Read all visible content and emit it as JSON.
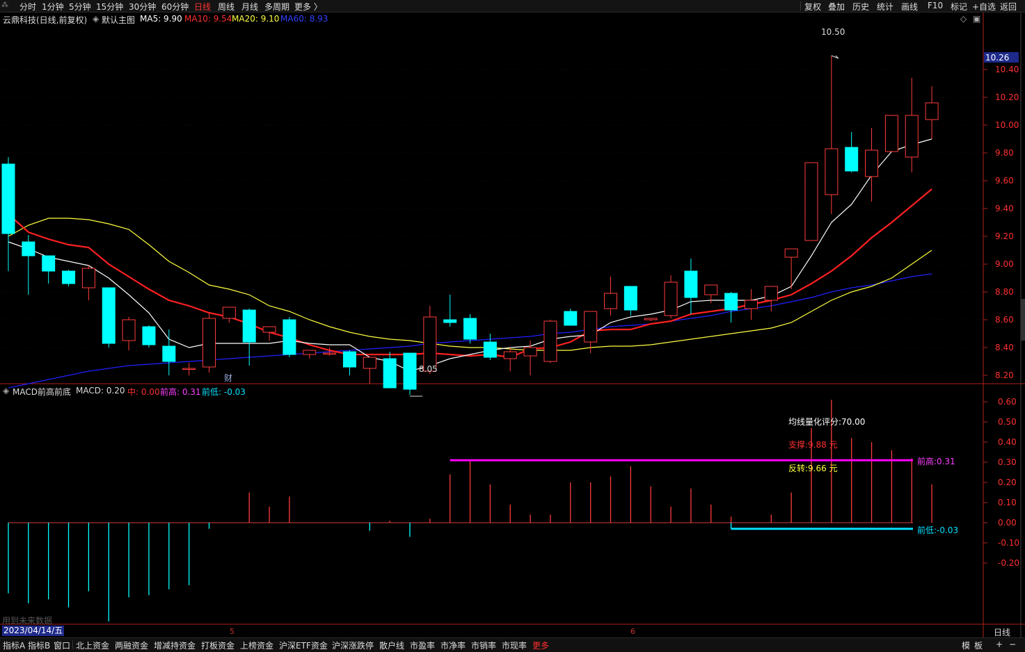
{
  "toolbar": {
    "periods": [
      "分时",
      "1分钟",
      "5分钟",
      "15分钟",
      "30分钟",
      "60分钟",
      "日线",
      "周线",
      "月线",
      "多周期",
      "更多 〉"
    ],
    "active_period": "日线",
    "right_buttons": [
      "复权",
      "叠加",
      "历史",
      "统计",
      "画线",
      "F10",
      "标记",
      "+自选",
      "返回"
    ]
  },
  "main_info": {
    "title": "云鼎科技(日线,前复权)",
    "template": "默认主图",
    "ma5": "MA5: 9.90",
    "ma10": "MA10: 9.54",
    "ma20": "MA20: 9.10",
    "ma60": "MA60: 8.93"
  },
  "macd_info": {
    "title": "MACD前高前底",
    "macd": "MACD: 0.20",
    "zhong": "中: 0.00",
    "qiangao": "前高: 0.31",
    "qiandi": "前低: -0.03"
  },
  "annotations": {
    "high_label": "10.50",
    "low_label": "8.05",
    "cai": "财",
    "score": "均线量化评分:70.00",
    "support": "支撑:9.88 元",
    "reversal": "反转:9.66 元",
    "prev_high": "前高:0.31",
    "prev_low": "前低:-0.03",
    "future_hint": "用到未来数据",
    "current_price": "10.26"
  },
  "bottom": {
    "date": "2023/04/14/五",
    "month_marks": [
      "5",
      "6"
    ],
    "day_label": "日线",
    "tabs": [
      "指标A",
      "指标B",
      "窗口",
      "北上资金",
      "两融资金",
      "增减持资金",
      "打板资金",
      "上榜资金",
      "沪深ETF资金",
      "沪深涨跌停",
      "散户线",
      "市盈率",
      "市净率",
      "市销率",
      "市现率",
      "更多"
    ],
    "right_tabs": [
      "模",
      "板",
      "+",
      "−"
    ]
  },
  "colors": {
    "up": "#ff3b3b",
    "down": "#00ffff",
    "ma5": "#ffffff",
    "ma10": "#ff2020",
    "ma20": "#ffff40",
    "ma60": "#2020ff",
    "prev_high_line": "#ff00ff",
    "prev_low_line": "#00e0ff"
  },
  "chart_data": [
    {
      "type": "candlestick",
      "title": "云鼎科技(日线,前复权)",
      "yticks": [
        "8.20",
        "8.40",
        "8.60",
        "8.80",
        "9.00",
        "9.20",
        "9.40",
        "9.60",
        "9.80",
        "10.00",
        "10.20",
        "10.40"
      ],
      "ylim": [
        8.0,
        10.5
      ],
      "ohlc": [
        [
          9.72,
          9.77,
          8.95,
          9.22
        ],
        [
          9.16,
          9.21,
          8.78,
          9.06
        ],
        [
          9.06,
          9.06,
          8.86,
          8.95
        ],
        [
          8.95,
          8.96,
          8.84,
          8.86
        ],
        [
          8.83,
          8.99,
          8.74,
          8.97
        ],
        [
          8.83,
          8.83,
          8.4,
          8.43
        ],
        [
          8.45,
          8.62,
          8.38,
          8.6
        ],
        [
          8.55,
          8.56,
          8.4,
          8.42
        ],
        [
          8.41,
          8.53,
          8.2,
          8.3
        ],
        [
          8.25,
          8.29,
          8.2,
          8.25
        ],
        [
          8.26,
          8.65,
          8.22,
          8.61
        ],
        [
          8.61,
          8.69,
          8.58,
          8.69
        ],
        [
          8.67,
          8.68,
          8.27,
          8.44
        ],
        [
          8.51,
          8.55,
          8.45,
          8.55
        ],
        [
          8.6,
          8.62,
          8.33,
          8.35
        ],
        [
          8.35,
          8.38,
          8.32,
          8.38
        ],
        [
          8.36,
          8.4,
          8.34,
          8.36
        ],
        [
          8.37,
          8.38,
          8.2,
          8.26
        ],
        [
          8.25,
          8.32,
          8.14,
          8.33
        ],
        [
          8.32,
          8.37,
          8.11,
          8.11
        ],
        [
          8.36,
          8.32,
          8.06,
          8.1
        ],
        [
          8.23,
          8.7,
          8.21,
          8.62
        ],
        [
          8.6,
          8.78,
          8.55,
          8.58
        ],
        [
          8.61,
          8.64,
          8.43,
          8.46
        ],
        [
          8.44,
          8.5,
          8.31,
          8.33
        ],
        [
          8.32,
          8.4,
          8.23,
          8.37
        ],
        [
          8.34,
          8.45,
          8.2,
          8.4
        ],
        [
          8.3,
          8.6,
          8.29,
          8.59
        ],
        [
          8.66,
          8.68,
          8.56,
          8.56
        ],
        [
          8.44,
          8.66,
          8.36,
          8.66
        ],
        [
          8.68,
          8.91,
          8.63,
          8.79
        ],
        [
          8.84,
          8.84,
          8.63,
          8.67
        ],
        [
          8.6,
          8.61,
          8.59,
          8.61
        ],
        [
          8.63,
          8.92,
          8.61,
          8.87
        ],
        [
          8.95,
          9.04,
          8.64,
          8.76
        ],
        [
          8.78,
          8.84,
          8.72,
          8.85
        ],
        [
          8.79,
          8.8,
          8.58,
          8.67
        ],
        [
          8.68,
          8.82,
          8.6,
          8.74
        ],
        [
          8.74,
          8.8,
          8.66,
          8.84
        ],
        [
          9.05,
          9.1,
          8.82,
          9.11
        ],
        [
          9.17,
          9.35,
          9.21,
          9.73
        ],
        [
          9.5,
          10.5,
          9.36,
          9.83
        ],
        [
          9.84,
          9.95,
          9.66,
          9.67
        ],
        [
          9.63,
          9.98,
          9.45,
          9.82
        ],
        [
          9.81,
          10.06,
          9.82,
          10.07
        ],
        [
          9.77,
          10.34,
          9.66,
          10.07
        ],
        [
          10.04,
          10.28,
          9.9,
          10.16
        ]
      ],
      "ma5": [
        9.16,
        9.11,
        9.05,
        9.02,
        8.99,
        8.9,
        8.78,
        8.65,
        8.46,
        8.4,
        8.43,
        8.43,
        8.43,
        8.43,
        8.45,
        8.43,
        8.42,
        8.42,
        8.33,
        8.3,
        8.23,
        8.27,
        8.32,
        8.35,
        8.38,
        8.4,
        8.41,
        8.46,
        8.48,
        8.49,
        8.58,
        8.62,
        8.64,
        8.67,
        8.73,
        8.74,
        8.74,
        8.74,
        8.77,
        8.84,
        9.06,
        9.3,
        9.43,
        9.64,
        9.81,
        9.86,
        9.9
      ],
      "ma10": [
        9.36,
        9.23,
        9.18,
        9.14,
        9.12,
        9.0,
        8.91,
        8.82,
        8.74,
        8.7,
        8.65,
        8.62,
        8.57,
        8.51,
        8.47,
        8.42,
        8.38,
        8.35,
        8.35,
        8.35,
        8.35,
        8.36,
        8.35,
        8.34,
        8.35,
        8.33,
        8.39,
        8.4,
        8.44,
        8.52,
        8.53,
        8.53,
        8.57,
        8.59,
        8.64,
        8.66,
        8.68,
        8.71,
        8.74,
        8.78,
        8.86,
        8.95,
        9.06,
        9.19,
        9.3,
        9.42,
        9.54
      ],
      "ma20": [
        9.2,
        9.28,
        9.33,
        9.33,
        9.32,
        9.29,
        9.25,
        9.14,
        9.02,
        8.94,
        8.85,
        8.82,
        8.78,
        8.7,
        8.66,
        8.6,
        8.55,
        8.51,
        8.48,
        8.46,
        8.45,
        8.43,
        8.41,
        8.4,
        8.4,
        8.39,
        8.38,
        8.38,
        8.38,
        8.4,
        8.41,
        8.41,
        8.42,
        8.44,
        8.46,
        8.48,
        8.5,
        8.52,
        8.54,
        8.58,
        8.66,
        8.74,
        8.8,
        8.84,
        8.9,
        9.0,
        9.1
      ],
      "ma60": [
        8.11,
        8.14,
        8.17,
        8.2,
        8.23,
        8.25,
        8.27,
        8.28,
        8.29,
        8.3,
        8.31,
        8.32,
        8.33,
        8.34,
        8.35,
        8.36,
        8.37,
        8.38,
        8.39,
        8.4,
        8.41,
        8.43,
        8.44,
        8.45,
        8.46,
        8.47,
        8.48,
        8.5,
        8.51,
        8.53,
        8.55,
        8.56,
        8.57,
        8.59,
        8.61,
        8.63,
        8.66,
        8.68,
        8.7,
        8.73,
        8.76,
        8.8,
        8.83,
        8.85,
        8.88,
        8.91,
        8.93
      ]
    },
    {
      "type": "bar",
      "title": "MACD前高前底",
      "yticks": [
        "0.60",
        "0.50",
        "0.40",
        "0.30",
        "0.20",
        "0.10",
        "0.00",
        "-0.10",
        "-0.20"
      ],
      "ylim": [
        -0.25,
        0.62
      ],
      "values": [
        -0.35,
        -0.4,
        -0.38,
        -0.42,
        -0.34,
        -0.49,
        -0.37,
        -0.36,
        -0.33,
        -0.31,
        -0.03,
        0.0,
        0.15,
        0.08,
        0.13,
        0.0,
        0.0,
        0.0,
        -0.04,
        0.01,
        -0.07,
        0.02,
        0.24,
        0.31,
        0.19,
        0.09,
        0.04,
        0.04,
        0.2,
        0.2,
        0.23,
        0.28,
        0.18,
        0.08,
        0.17,
        0.09,
        0.03,
        0.0,
        0.04,
        0.15,
        0.47,
        0.61,
        0.42,
        0.4,
        0.36,
        0.32,
        0.19
      ],
      "prev_high": 0.31,
      "prev_low": -0.03
    }
  ]
}
